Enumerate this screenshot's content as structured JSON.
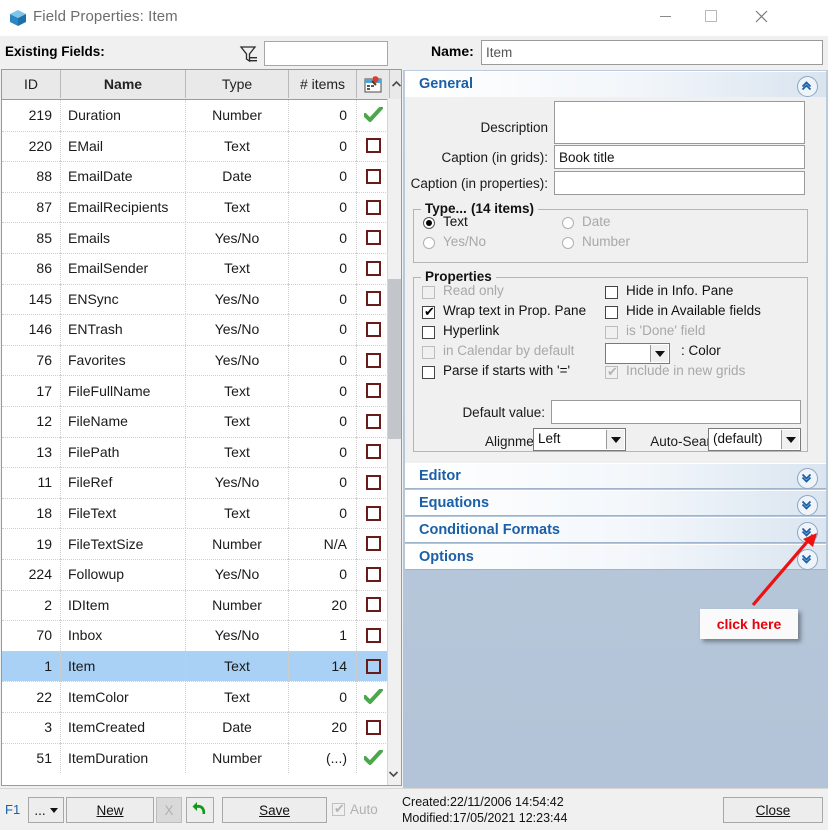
{
  "window": {
    "title": "Field Properties: Item",
    "icon": "cube-icon",
    "minimize": "minimize-icon",
    "maximize": "maximize-icon",
    "close": "close-icon"
  },
  "left": {
    "existing_fields_label": "Existing Fields:",
    "filter_icon": "filter-icon",
    "filter_value": "",
    "filter_placeholder": "",
    "columns": [
      "ID",
      "Name",
      "Type",
      "# items",
      "calendar-icon"
    ],
    "rows": [
      {
        "id": "219",
        "name": "Duration",
        "type": "Number",
        "items": "0",
        "check": "tick"
      },
      {
        "id": "220",
        "name": "EMail",
        "type": "Text",
        "items": "0",
        "check": "box"
      },
      {
        "id": "88",
        "name": "EmailDate",
        "type": "Date",
        "items": "0",
        "check": "box"
      },
      {
        "id": "87",
        "name": "EmailRecipients",
        "type": "Text",
        "items": "0",
        "check": "box"
      },
      {
        "id": "85",
        "name": "Emails",
        "type": "Yes/No",
        "items": "0",
        "check": "box"
      },
      {
        "id": "86",
        "name": "EmailSender",
        "type": "Text",
        "items": "0",
        "check": "box"
      },
      {
        "id": "145",
        "name": "ENSync",
        "type": "Yes/No",
        "items": "0",
        "check": "box"
      },
      {
        "id": "146",
        "name": "ENTrash",
        "type": "Yes/No",
        "items": "0",
        "check": "box"
      },
      {
        "id": "76",
        "name": "Favorites",
        "type": "Yes/No",
        "items": "0",
        "check": "box"
      },
      {
        "id": "17",
        "name": "FileFullName",
        "type": "Text",
        "items": "0",
        "check": "box"
      },
      {
        "id": "12",
        "name": "FileName",
        "type": "Text",
        "items": "0",
        "check": "box"
      },
      {
        "id": "13",
        "name": "FilePath",
        "type": "Text",
        "items": "0",
        "check": "box"
      },
      {
        "id": "11",
        "name": "FileRef",
        "type": "Yes/No",
        "items": "0",
        "check": "box"
      },
      {
        "id": "18",
        "name": "FileText",
        "type": "Text",
        "items": "0",
        "check": "box"
      },
      {
        "id": "19",
        "name": "FileTextSize",
        "type": "Number",
        "items": "N/A",
        "check": "box"
      },
      {
        "id": "224",
        "name": "Followup",
        "type": "Yes/No",
        "items": "0",
        "check": "box"
      },
      {
        "id": "2",
        "name": "IDItem",
        "type": "Number",
        "items": "20",
        "check": "box"
      },
      {
        "id": "70",
        "name": "Inbox",
        "type": "Yes/No",
        "items": "1",
        "check": "box"
      },
      {
        "id": "1",
        "name": "Item",
        "type": "Text",
        "items": "14",
        "check": "box",
        "selected": true
      },
      {
        "id": "22",
        "name": "ItemColor",
        "type": "Text",
        "items": "0",
        "check": "tick"
      },
      {
        "id": "3",
        "name": "ItemCreated",
        "type": "Date",
        "items": "20",
        "check": "box"
      },
      {
        "id": "51",
        "name": "ItemDuration",
        "type": "Number",
        "items": "(...)",
        "check": "tick"
      }
    ]
  },
  "right": {
    "name_label": "Name:",
    "name_value": "Item",
    "general": {
      "title": "General",
      "collapse_icon": "chevron-up-icon",
      "description_label": "Description",
      "description_value": "",
      "caption_grids_label": "Caption (in grids):",
      "caption_grids_value": "Book title",
      "caption_props_label": "Caption (in properties):",
      "caption_props_value": "",
      "type_group_label": "Type...",
      "type_group_count": "(14 items)",
      "type_options": [
        {
          "label": "Text",
          "selected": true,
          "disabled": false
        },
        {
          "label": "Date",
          "selected": false,
          "disabled": true
        },
        {
          "label": "Yes/No",
          "selected": false,
          "disabled": true
        },
        {
          "label": "Number",
          "selected": false,
          "disabled": true
        }
      ],
      "properties_group_label": "Properties",
      "properties_left": [
        {
          "label": "Read only",
          "checked": false,
          "disabled": true
        },
        {
          "label": "Wrap text in Prop. Pane",
          "checked": true,
          "disabled": false
        },
        {
          "label": "Hyperlink",
          "checked": false,
          "disabled": false
        },
        {
          "label": "in Calendar by default",
          "checked": false,
          "disabled": true
        },
        {
          "label": "Parse if starts with '='",
          "checked": false,
          "disabled": false
        }
      ],
      "properties_right": [
        {
          "label": "Hide in Info. Pane",
          "checked": false,
          "disabled": false
        },
        {
          "label": "Hide in Available fields",
          "checked": false,
          "disabled": false
        },
        {
          "label": "is 'Done' field",
          "checked": false,
          "disabled": true
        },
        {
          "label": "Include in new grids",
          "checked": true,
          "disabled": true
        }
      ],
      "color_label": ": Color",
      "color_value": "",
      "default_value_label": "Default value:",
      "default_value": "",
      "alignment_label": "Alignment",
      "alignment_value": "Left",
      "autosearch_label": "Auto-Search:",
      "autosearch_value": "(default)"
    },
    "sections": [
      {
        "title": "Editor",
        "icon": "chevron-down-icon"
      },
      {
        "title": "Equations",
        "icon": "chevron-down-icon"
      },
      {
        "title": "Conditional Formats",
        "icon": "chevron-down-icon"
      },
      {
        "title": "Options",
        "icon": "chevron-down-icon"
      }
    ],
    "callout": {
      "text": "click here",
      "color": "#e8000d",
      "arrow": "red-arrow-icon"
    }
  },
  "bottom": {
    "f1": "F1",
    "more_label": "...",
    "new_label": "New",
    "delete_label": "X",
    "undo_icon": "undo-arrow-icon",
    "save_label": "Save",
    "auto_label": "Auto",
    "auto_checked": true,
    "created": "Created:22/11/2006 14:54:42",
    "modified": "Modified:17/05/2021 12:23:44",
    "close_label": "Close"
  }
}
